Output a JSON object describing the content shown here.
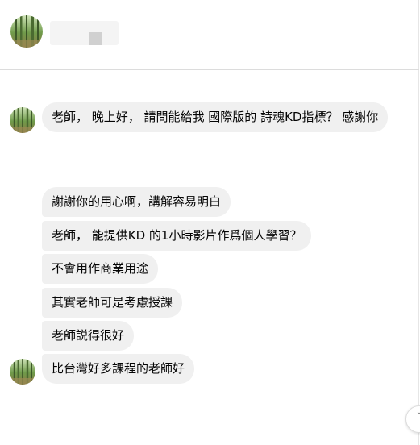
{
  "messages": [
    "老師， 晚上好， 請問能給我 國際版的 詩魂KD指標？ 感謝你",
    "謝謝你的用心啊，講解容易明白",
    "老師， 能提供KD 的1小時影片作爲個人學習？",
    "不會用作商業用途",
    "其實老師可是考慮授課",
    "老師説得很好",
    "比台灣好多課程的老師好"
  ],
  "scroll_button": {
    "label": "ˇ"
  }
}
